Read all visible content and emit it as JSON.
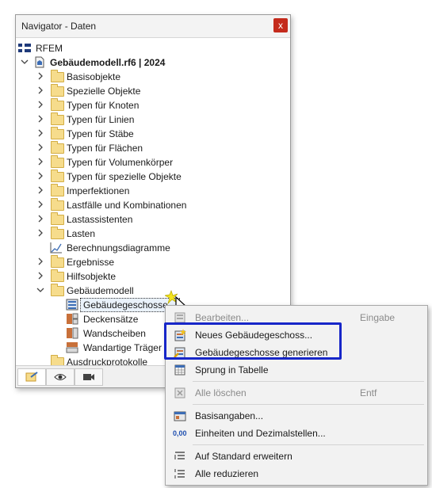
{
  "window": {
    "title": "Navigator - Daten",
    "close_glyph": "x"
  },
  "tree": {
    "root": "RFEM",
    "model": "Gebäudemodell.rf6 | 2024",
    "items": [
      "Basisobjekte",
      "Spezielle Objekte",
      "Typen für Knoten",
      "Typen für Linien",
      "Typen für Stäbe",
      "Typen für Flächen",
      "Typen für Volumenkörper",
      "Typen für spezielle Objekte",
      "Imperfektionen",
      "Lastfälle und Kombinationen",
      "Lastassistenten",
      "Lasten",
      "Berechnungsdiagramme",
      "Ergebnisse",
      "Hilfsobjekte",
      "Gebäudemodell",
      "Gebäudegeschosse",
      "Deckensätze",
      "Wandscheiben",
      "Wandartige Träger",
      "Ausdruckprotokolle"
    ]
  },
  "menu": {
    "edit": {
      "label": "Bearbeiten...",
      "shortcut": "Eingabe"
    },
    "new_storey": "Neues Gebäudegeschoss...",
    "generate": "Gebäudegeschosse generieren",
    "jump": "Sprung in Tabelle",
    "delete_all": {
      "label": "Alle löschen",
      "shortcut": "Entf"
    },
    "basic": "Basisangaben...",
    "units": "Einheiten und Dezimalstellen...",
    "expand": "Auf Standard erweitern",
    "collapse": "Alle reduzieren",
    "units_icon_text": "0,00"
  },
  "colors": {
    "highlight": "#1726c8",
    "close": "#c42b1c",
    "folder": "#f6dc8c"
  }
}
